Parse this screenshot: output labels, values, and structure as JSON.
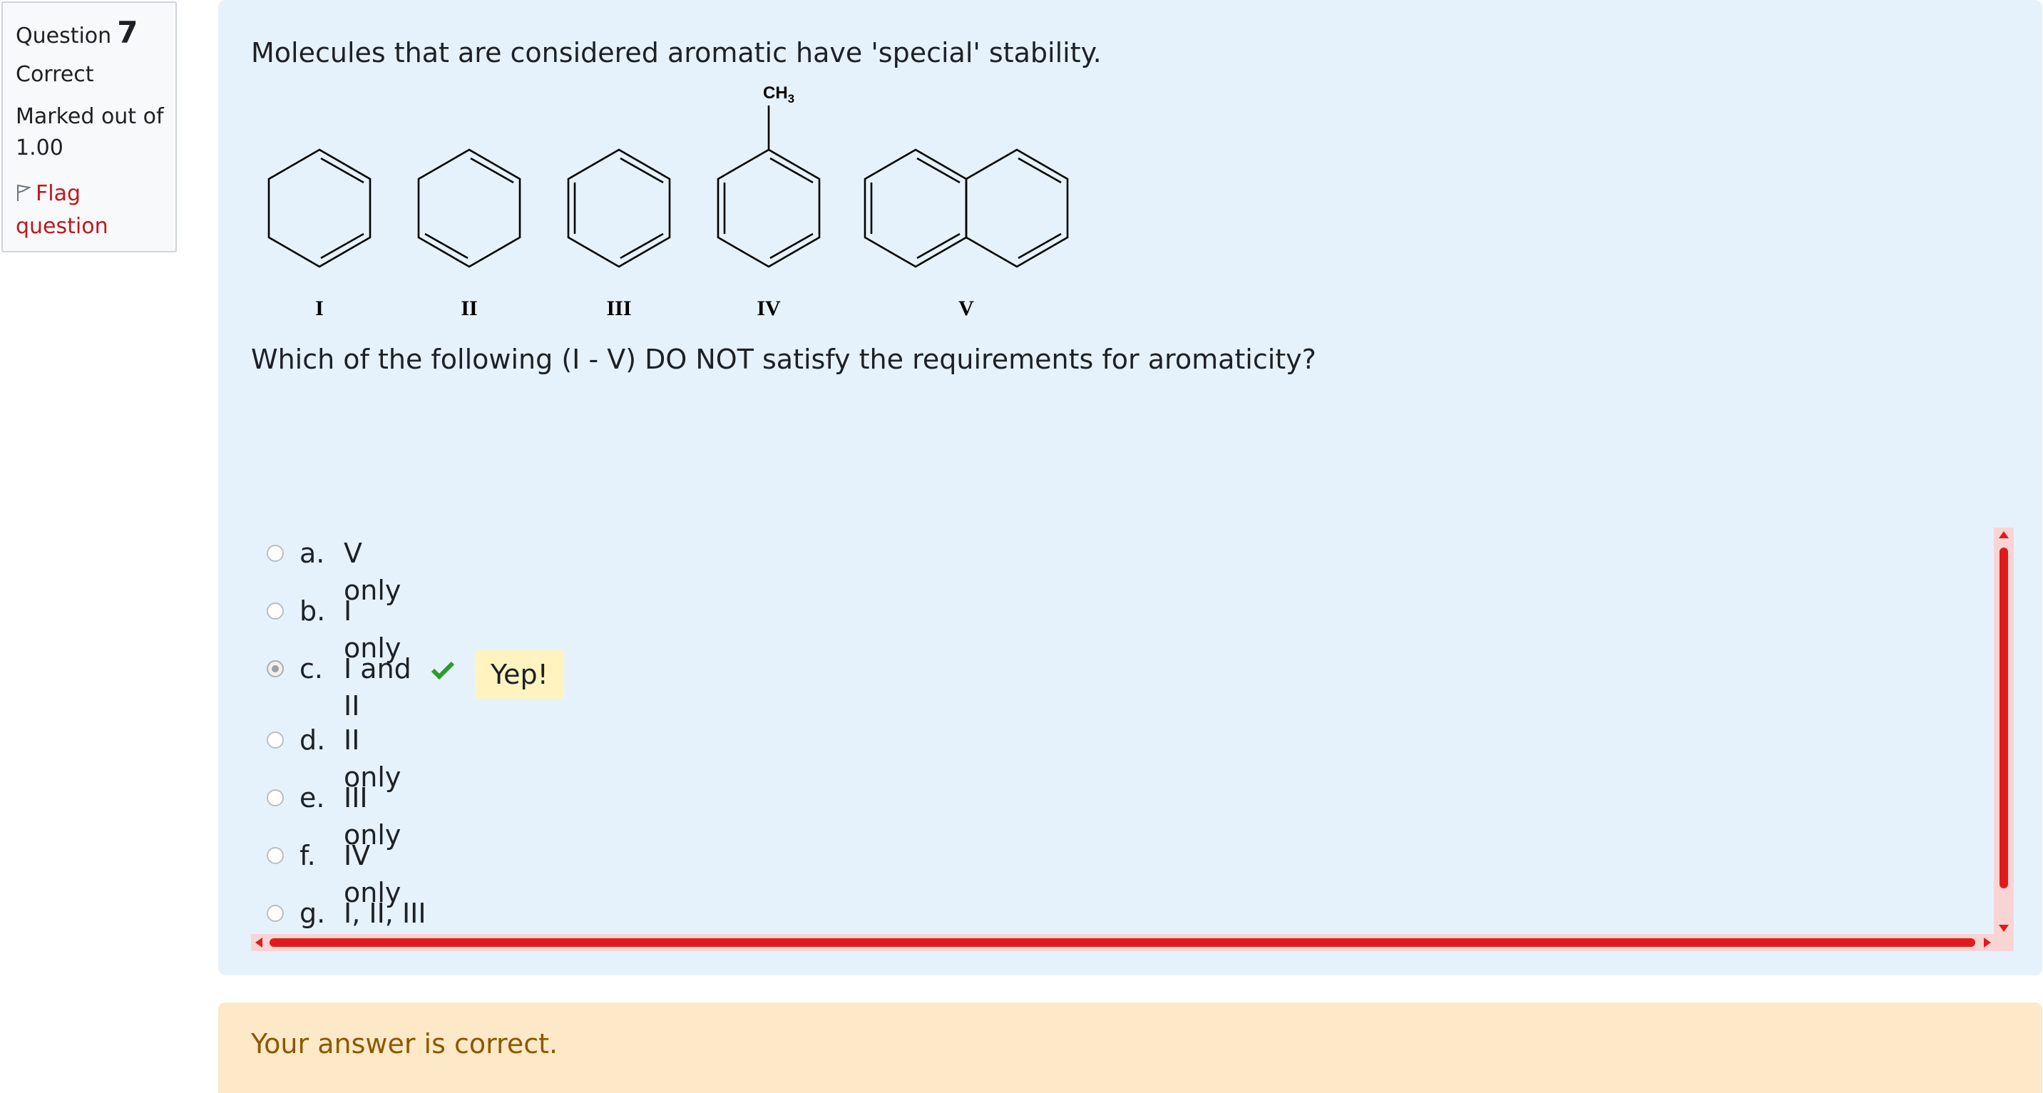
{
  "info": {
    "question_label": "Question",
    "question_number": "7",
    "state": "Correct",
    "grade": "Marked out of 1.00",
    "flag_label": "Flag question"
  },
  "question": {
    "text": "Molecules that are considered aromatic have 'special' stability.",
    "structure_labels": [
      "I",
      "II",
      "III",
      "IV",
      "V"
    ],
    "substituent": "CH",
    "substituent_subscript": "3",
    "prompt": "Which of the following (I - V) DO NOT satisfy the requirements for aromaticity?"
  },
  "answers": [
    {
      "letter": "a.",
      "text": "V only",
      "selected": false
    },
    {
      "letter": "b.",
      "text": "I only",
      "selected": false
    },
    {
      "letter": "c.",
      "text": "I and II",
      "selected": true,
      "feedback": "Yep!"
    },
    {
      "letter": "d.",
      "text": "II only",
      "selected": false
    },
    {
      "letter": "e.",
      "text": "III only",
      "selected": false
    },
    {
      "letter": "f.",
      "text": "IV only",
      "selected": false
    },
    {
      "letter": "g.",
      "text": "I, II, III",
      "selected": false
    }
  ],
  "outcome": {
    "message": "Your answer is correct."
  },
  "colors": {
    "panel": "#e6f2fb",
    "outcome": "#fde8c8",
    "flag": "#c4161c",
    "tick": "#2a9d2a",
    "feedback": "#fff3bf",
    "scrollbar": "#e01b1b"
  }
}
